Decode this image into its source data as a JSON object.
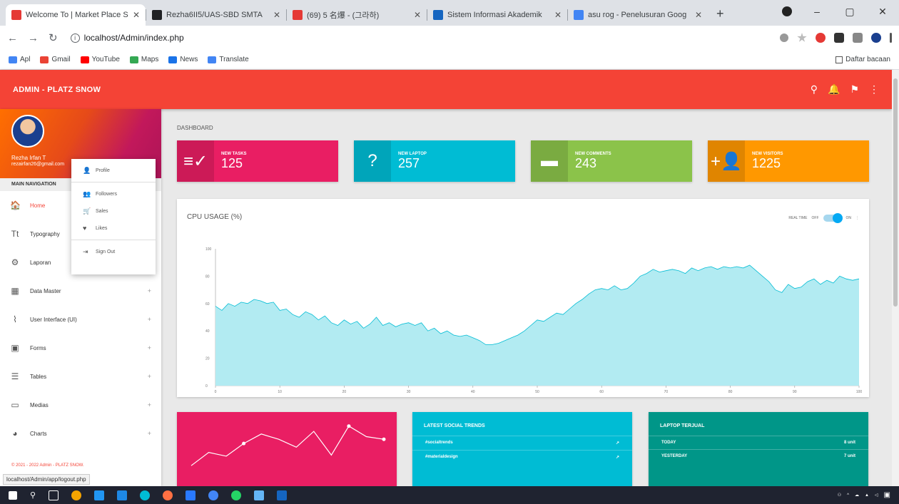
{
  "browser": {
    "tabs": [
      {
        "title": "Welcome To | Market Place S",
        "color": "#e53935"
      },
      {
        "title": "Rezha6II5/UAS-SBD SMTA",
        "color": "#202124"
      },
      {
        "title": "(69) 5 名爆 - (그라하)",
        "color": "#e53935"
      },
      {
        "title": "Sistem Informasi Akademik",
        "color": "#1565c0"
      },
      {
        "title": "asu rog - Penelusuran Goog",
        "color": "#4285f4"
      }
    ],
    "url": "localhost/Admin/index.php",
    "bookmarks": [
      "Apl",
      "Gmail",
      "YouTube",
      "Maps",
      "News",
      "Translate"
    ],
    "bookmarks_right": "Daftar bacaan",
    "status_url": "localhost/Admin/app/logout.php"
  },
  "header": {
    "brand": "ADMIN - PLATZ SNOW"
  },
  "user": {
    "name": "Rezha Irfan T",
    "email": "rezairfan26@gmail.com"
  },
  "sidebar": {
    "nav_title": "MAIN NAVIGATION",
    "items": [
      {
        "label": "Home",
        "icon": "home-icon",
        "glyph": "🏠"
      },
      {
        "label": "Typography",
        "icon": "text-fields-icon",
        "glyph": "Tt"
      },
      {
        "label": "Laporan",
        "icon": "settings-icon",
        "glyph": "⚙"
      },
      {
        "label": "Data Master",
        "icon": "grid-icon",
        "glyph": "▦"
      },
      {
        "label": "User Interface (UI)",
        "icon": "layers-icon",
        "glyph": "⌇"
      },
      {
        "label": "Forms",
        "icon": "form-icon",
        "glyph": "▣"
      },
      {
        "label": "Tables",
        "icon": "list-icon",
        "glyph": "☰"
      },
      {
        "label": "Medias",
        "icon": "media-icon",
        "glyph": "▭"
      },
      {
        "label": "Charts",
        "icon": "pie-chart-icon",
        "glyph": "◕"
      }
    ],
    "footer": "© 2021 - 2022 Admin - PLATZ SNOW."
  },
  "dropdown": {
    "items": [
      {
        "label": "Profile",
        "glyph": "👤"
      },
      {
        "label": "Followers",
        "glyph": "👥"
      },
      {
        "label": "Sales",
        "glyph": "🛒"
      },
      {
        "label": "Likes",
        "glyph": "♥"
      },
      {
        "label": "Sign Out",
        "glyph": "⇥"
      }
    ]
  },
  "dashboard": {
    "title": "DASHBOARD",
    "boxes": [
      {
        "label": "NEW TASKS",
        "value": "125",
        "color": "#e91e63",
        "glyph": "≡✓"
      },
      {
        "label": "NEW LAPTOP",
        "value": "257",
        "color": "#00bcd4",
        "glyph": "?"
      },
      {
        "label": "NEW COMMENTS",
        "value": "243",
        "color": "#8bc34a",
        "glyph": "▬"
      },
      {
        "label": "NEW VISITORS",
        "value": "1225",
        "color": "#ff9800",
        "glyph": "+👤"
      }
    ]
  },
  "cpu": {
    "title": "CPU USAGE (%)",
    "realtime_label": "REAL TIME",
    "off_label": "OFF",
    "on_label": "ON"
  },
  "chart_data": {
    "type": "area",
    "ylim": [
      0,
      100
    ],
    "xlim": [
      0,
      100
    ],
    "x_ticks": [
      0,
      10,
      20,
      30,
      40,
      50,
      60,
      70,
      80,
      90,
      100
    ],
    "y_ticks": [
      0,
      20,
      40,
      60,
      80,
      100
    ],
    "values": [
      58,
      55,
      60,
      58,
      61,
      60,
      63,
      62,
      60,
      61,
      55,
      56,
      52,
      50,
      54,
      52,
      48,
      51,
      46,
      44,
      48,
      45,
      47,
      42,
      45,
      50,
      44,
      46,
      43,
      45,
      46,
      44,
      46,
      40,
      42,
      38,
      40,
      37,
      36,
      37,
      35,
      33,
      30,
      30,
      31,
      33,
      35,
      37,
      40,
      44,
      48,
      47,
      50,
      53,
      52,
      56,
      60,
      63,
      67,
      70,
      71,
      70,
      73,
      70,
      71,
      75,
      80,
      82,
      85,
      83,
      84,
      85,
      84,
      82,
      86,
      84,
      86,
      87,
      85,
      87,
      86,
      87,
      86,
      88,
      84,
      80,
      76,
      70,
      68,
      74,
      71,
      72,
      76,
      78,
      74,
      77,
      75,
      80,
      78,
      77,
      78
    ],
    "color": "#b2ebf2",
    "line_color": "#00bcd4"
  },
  "bottom_cards": {
    "social": {
      "title": "LATEST SOCIAL TRENDS",
      "rows": [
        "#socialtrends",
        "#materialdesign"
      ]
    },
    "laptop": {
      "title": "LAPTOP TERJUAL",
      "rows": [
        {
          "k": "TODAY",
          "v": "8 unit"
        },
        {
          "k": "YESTERDAY",
          "v": "7 unit"
        }
      ]
    },
    "sparkline": [
      20,
      45,
      38,
      62,
      80,
      70,
      55,
      85,
      40,
      95,
      75,
      70
    ]
  }
}
